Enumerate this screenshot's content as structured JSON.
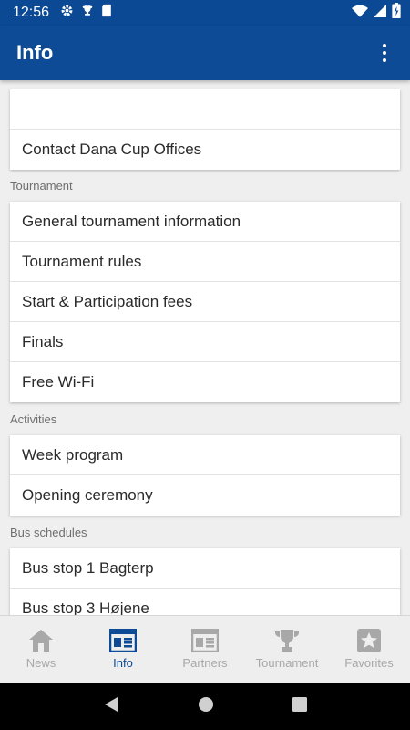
{
  "status_bar": {
    "time": "12:56",
    "left_icons": [
      "gear-icon",
      "trophy-icon",
      "sd-card-icon"
    ],
    "right_icons": [
      "wifi-icon",
      "signal-icon",
      "battery-charging-icon"
    ]
  },
  "app_bar": {
    "title": "Info",
    "menu_icon": "more-vert-icon"
  },
  "top_card": {
    "items": [
      {
        "label": ""
      },
      {
        "label": "Contact Dana Cup Offices"
      }
    ]
  },
  "sections": [
    {
      "label": "Tournament",
      "items": [
        {
          "label": "General tournament information"
        },
        {
          "label": "Tournament rules"
        },
        {
          "label": "Start & Participation fees"
        },
        {
          "label": "Finals"
        },
        {
          "label": "Free Wi-Fi"
        }
      ]
    },
    {
      "label": "Activities",
      "items": [
        {
          "label": "Week program"
        },
        {
          "label": "Opening ceremony"
        }
      ]
    },
    {
      "label": "Bus schedules",
      "items": [
        {
          "label": "Bus stop 1 Bagterp"
        },
        {
          "label": "Bus stop 3 Højene"
        }
      ]
    }
  ],
  "bottom_nav": {
    "items": [
      {
        "label": "News",
        "icon": "home-icon"
      },
      {
        "label": "Info",
        "icon": "info-page-icon",
        "active": true
      },
      {
        "label": "Partners",
        "icon": "partners-icon"
      },
      {
        "label": "Tournament",
        "icon": "trophy-icon"
      },
      {
        "label": "Favorites",
        "icon": "star-icon"
      }
    ]
  },
  "colors": {
    "primary": "#0d4b96",
    "inactive": "#a8a8a8",
    "background": "#efefef"
  }
}
